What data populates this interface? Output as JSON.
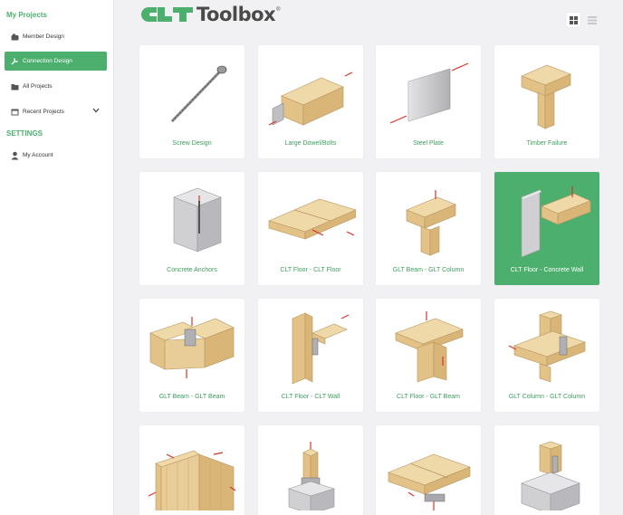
{
  "sidebar": {
    "section_projects": "My Projects",
    "items": [
      {
        "label": "Member Design",
        "icon": "member-design-icon"
      },
      {
        "label": "Connection Design",
        "icon": "wrench-icon",
        "active": true
      },
      {
        "label": "All Projects",
        "icon": "folder-icon"
      },
      {
        "label": "Recent Projects",
        "icon": "calendar-icon"
      }
    ],
    "section_settings": "SETTINGS",
    "account": {
      "label": "My Account",
      "icon": "user-icon"
    }
  },
  "header": {
    "logo_text": "Toolbox",
    "logo_reg": "®",
    "view_buttons": [
      "grid-view-icon",
      "list-view-icon"
    ]
  },
  "cards": [
    {
      "label": "Screw Design"
    },
    {
      "label": "Large Dowel/Bolts"
    },
    {
      "label": "Steel Plate"
    },
    {
      "label": "Timber Failure"
    },
    {
      "label": "Concrete Anchors"
    },
    {
      "label": "CLT Floor - CLT Floor"
    },
    {
      "label": "GLT Beam - GLT Column"
    },
    {
      "label": "CLT Floor - Concrete Wall",
      "selected": true
    },
    {
      "label": "GLT Beam - GLT Beam"
    },
    {
      "label": "CLT Floor - CLT Wall"
    },
    {
      "label": "CLT Floor - GLT Beam"
    },
    {
      "label": "GLT Column - GLT Column"
    },
    {
      "label": ""
    },
    {
      "label": ""
    },
    {
      "label": ""
    },
    {
      "label": ""
    }
  ],
  "colors": {
    "accent": "#4caf6e",
    "wood": "#e6c58f",
    "arrow": "#d9332b",
    "concrete": "#c9c9cc"
  }
}
